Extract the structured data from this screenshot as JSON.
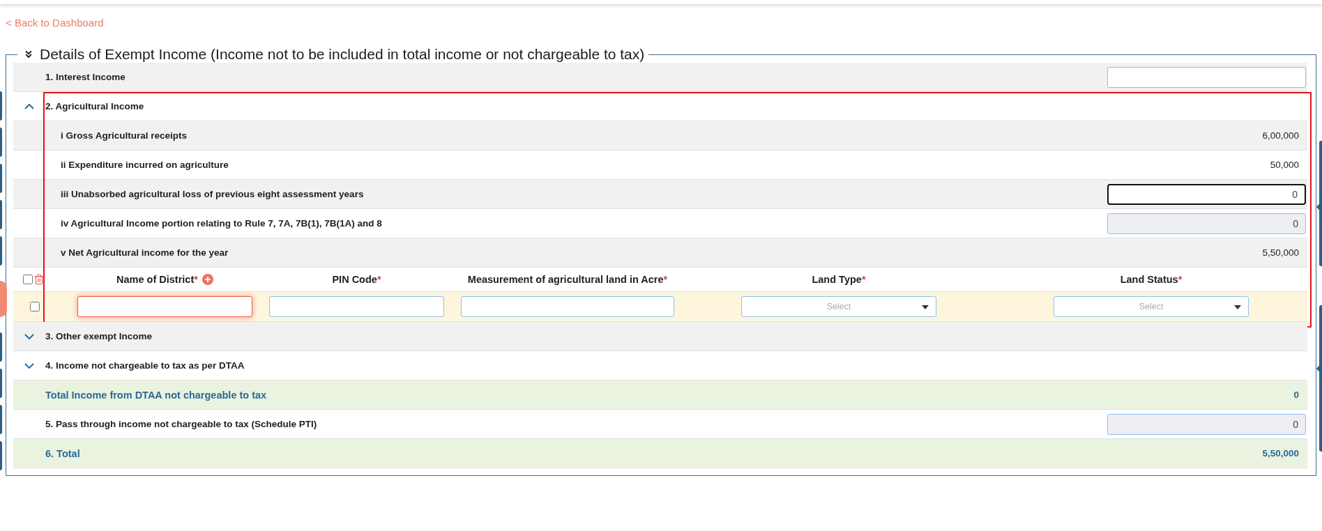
{
  "back_link": "< Back to Dashboard",
  "section": {
    "title": "Details of Exempt Income (Income not to be included in total income or not chargeable to tax)",
    "expanded": true
  },
  "rows": [
    {
      "kind": "field",
      "label": "1. Interest Income",
      "input": {
        "focused": false,
        "readonly": false
      }
    },
    {
      "kind": "group",
      "label": "2. Agricultural Income",
      "expanded": true,
      "highlighted": true,
      "children": [
        {
          "kind": "amount",
          "label": "i Gross Agricultural receipts",
          "value": "6,00,000"
        },
        {
          "kind": "amount",
          "label": "ii Expenditure incurred on agriculture",
          "value": "50,000"
        },
        {
          "kind": "field",
          "label": "iii Unabsorbed agricultural loss of previous eight assessment years",
          "input": {
            "value": "0",
            "focused": true,
            "readonly": false
          }
        },
        {
          "kind": "field",
          "label": "iv Agricultural Income portion relating to Rule 7, 7A, 7B(1), 7B(1A) and 8",
          "input": {
            "value": "0",
            "focused": false,
            "readonly": true
          }
        },
        {
          "kind": "amount",
          "label": "v Net Agricultural income for the year",
          "value": "5,50,000"
        }
      ],
      "land_table": {
        "all_checked": false,
        "columns": [
          {
            "label": "Name of District",
            "required_mark": "*",
            "add_button": true
          },
          {
            "label": "PIN Code",
            "required_mark": "*",
            "add_button": false
          },
          {
            "label": "Measurement of agricultural land in Acre",
            "required_mark": "*",
            "add_button": false
          },
          {
            "label": "Land Type",
            "required_mark": "*",
            "add_button": false
          },
          {
            "label": "Land Status",
            "required_mark": "*",
            "add_button": false
          }
        ],
        "rows": [
          {
            "checked": false,
            "cells": [
              {
                "kind": "text",
                "invalid": true
              },
              {
                "kind": "text",
                "invalid": false
              },
              {
                "kind": "text",
                "invalid": false
              },
              {
                "kind": "select",
                "placeholder": "Select"
              },
              {
                "kind": "select",
                "placeholder": "Select"
              }
            ]
          }
        ]
      }
    },
    {
      "kind": "group",
      "label": "3. Other exempt Income",
      "expanded": false
    },
    {
      "kind": "group",
      "label": "4. Income not chargeable to tax as per DTAA",
      "expanded": false
    },
    {
      "kind": "total",
      "label": "Total Income from DTAA not chargeable to tax",
      "value": "0"
    },
    {
      "kind": "field",
      "label": "5. Pass through income not chargeable to tax (Schedule PTI)",
      "input": {
        "value": "0",
        "focused": false,
        "readonly": true
      }
    },
    {
      "kind": "total",
      "label": "6. Total",
      "value": "5,50,000"
    }
  ]
}
